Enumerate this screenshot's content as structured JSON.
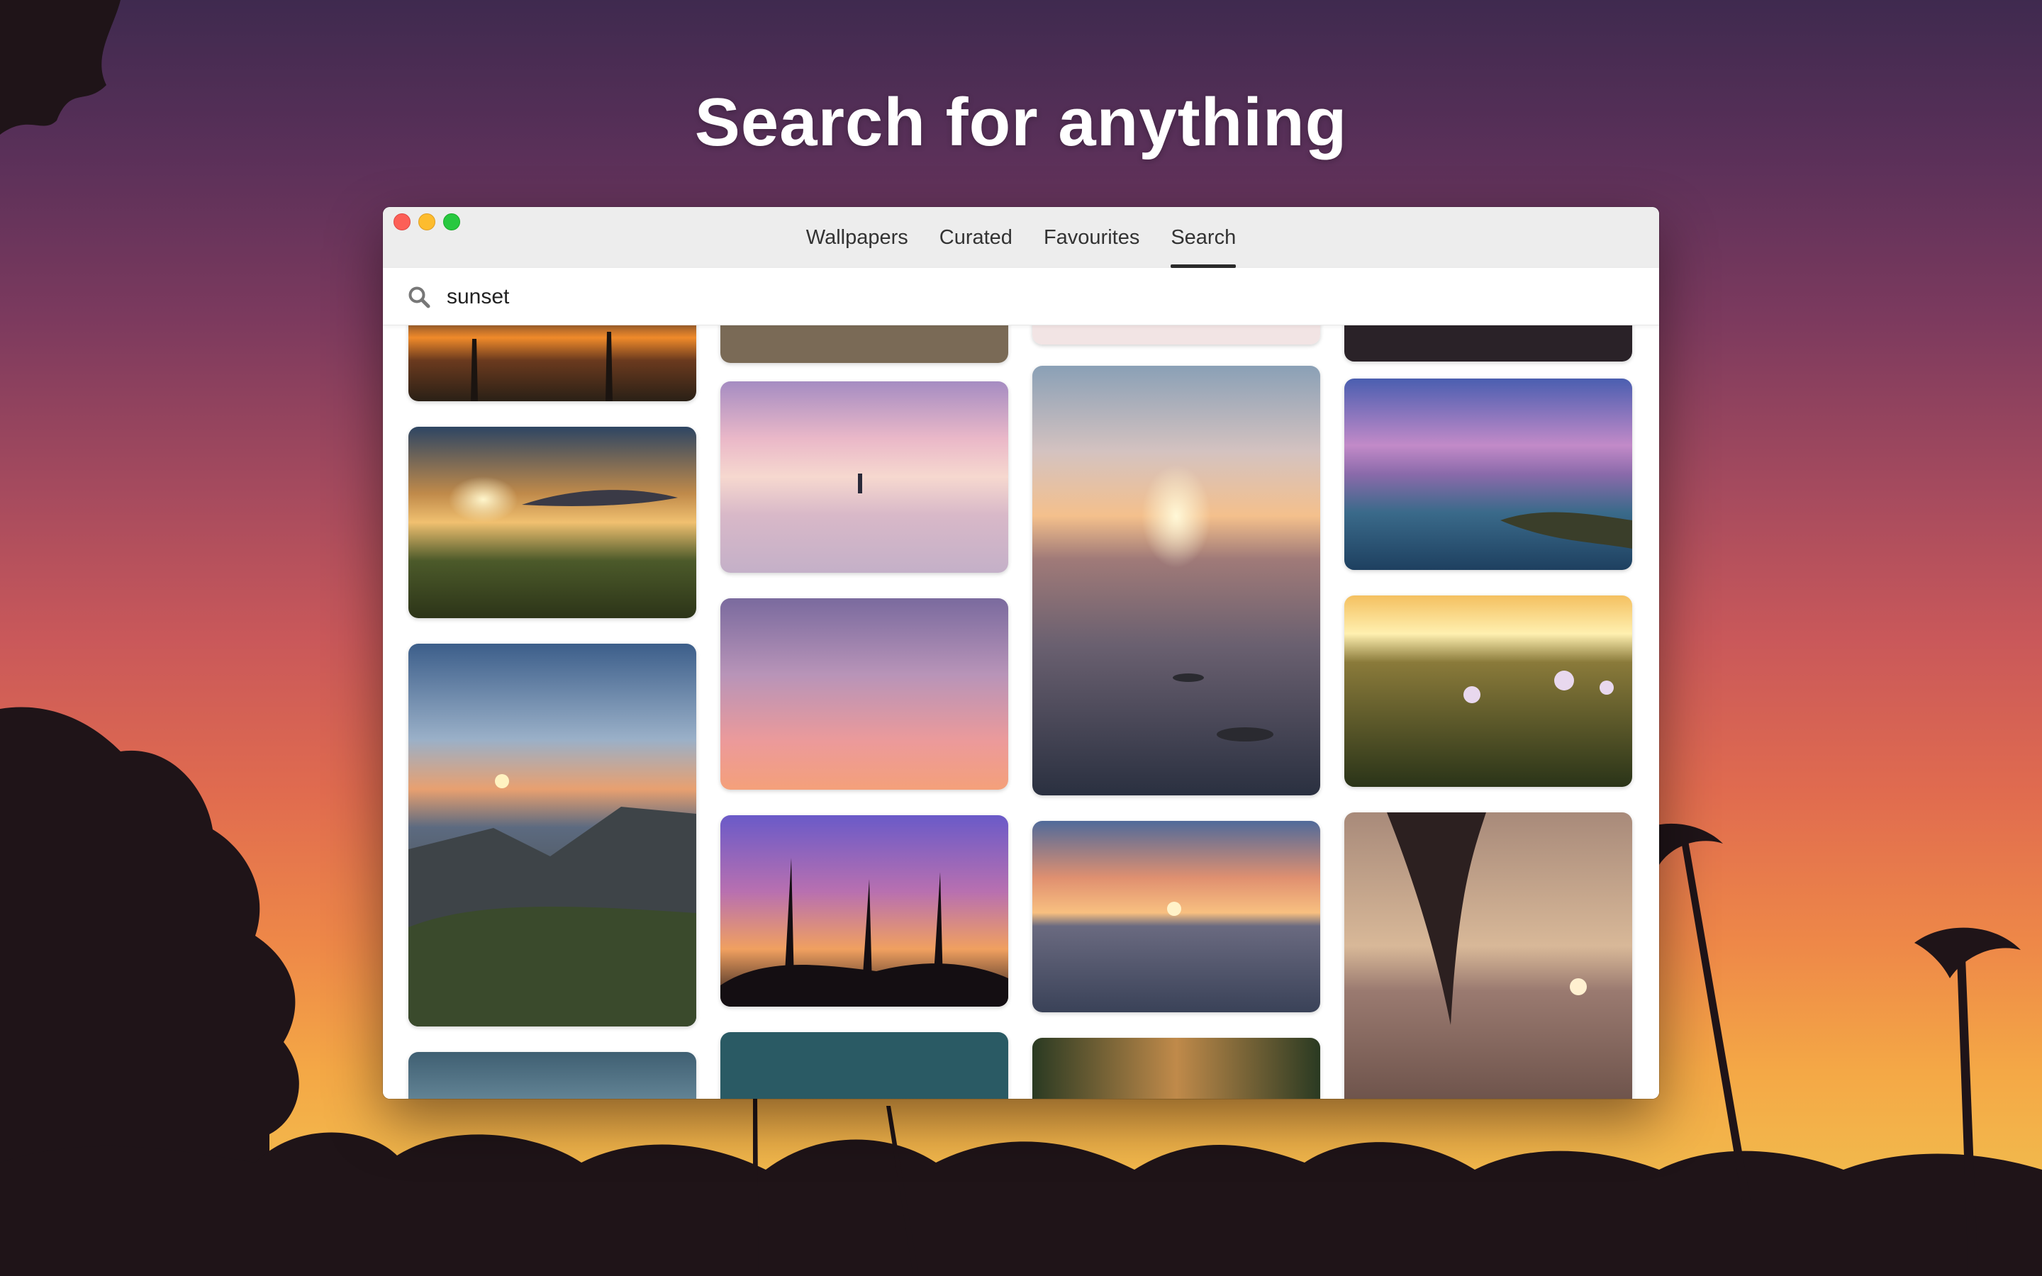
{
  "headline": "Search for anything",
  "window": {
    "tabs": [
      {
        "label": "Wallpapers"
      },
      {
        "label": "Curated"
      },
      {
        "label": "Favourites"
      },
      {
        "label": "Search"
      }
    ],
    "active_tab": "Search"
  },
  "search": {
    "value": "sunset",
    "icon": "magnifier-icon"
  },
  "results": {
    "query": "sunset",
    "columns": 4
  }
}
